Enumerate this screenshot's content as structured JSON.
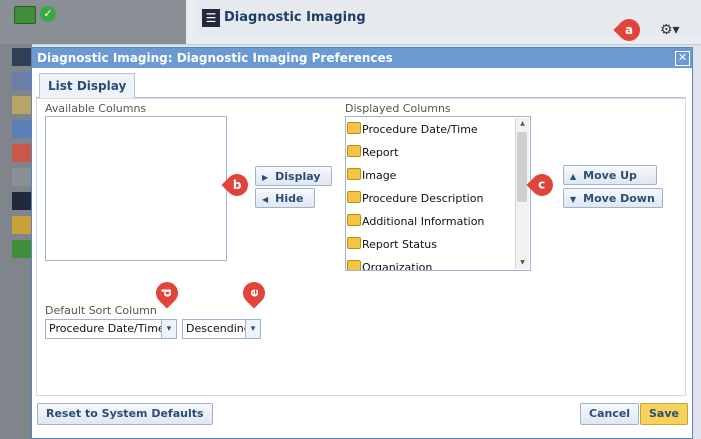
{
  "app_header": {
    "module_title": "Diagnostic Imaging",
    "module_icon": "imaging-icon",
    "gear_label": "⚙▾"
  },
  "dialog": {
    "title": "Diagnostic Imaging: Diagnostic Imaging Preferences",
    "close_label": "✕"
  },
  "tabs": [
    {
      "label": "List Display",
      "active": true
    }
  ],
  "available_columns": {
    "label": "Available Columns",
    "items": []
  },
  "displayed_columns": {
    "label": "Displayed Columns",
    "items": [
      "Procedure Date/Time",
      "Report",
      "Image",
      "Procedure Description",
      "Additional Information",
      "Report Status",
      "Organization"
    ]
  },
  "buttons": {
    "display": "Display",
    "hide": "Hide",
    "move_up": "Move Up",
    "move_down": "Move Down",
    "reset": "Reset to System Defaults",
    "cancel": "Cancel",
    "save": "Save"
  },
  "sort": {
    "label": "Default Sort Column",
    "column": "Procedure Date/Time",
    "order": "Descending"
  },
  "markers": {
    "a": "a",
    "b": "b",
    "c": "c",
    "d": "d",
    "e": "e"
  },
  "colors": {
    "header_bar": "#6b9ad3",
    "marker": "#e0443b",
    "save": "#f7d25b"
  }
}
